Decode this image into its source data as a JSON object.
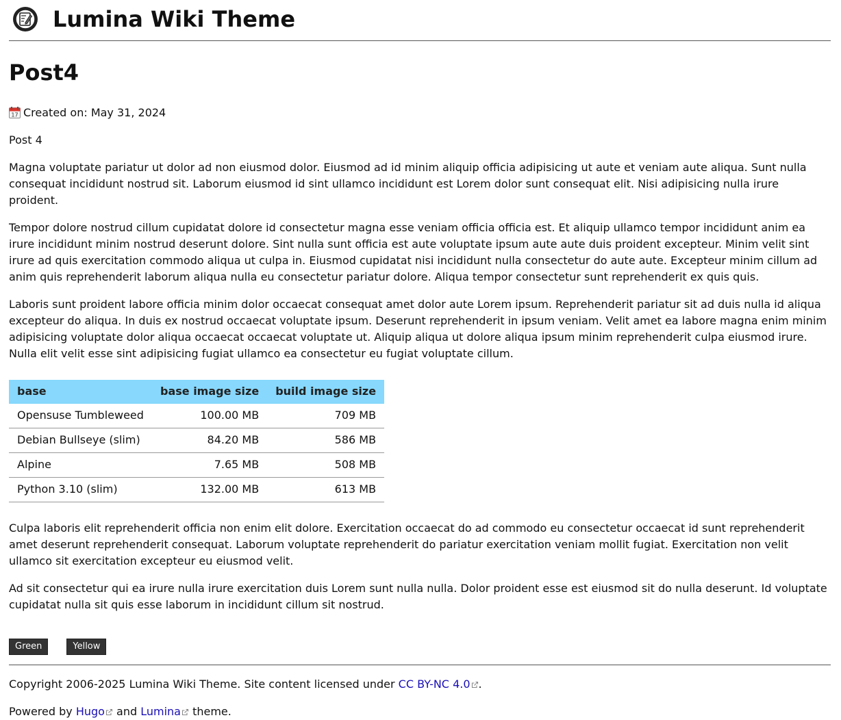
{
  "site": {
    "title": "Lumina Wiki Theme",
    "logo_icon": "notebook-pen-logo-icon"
  },
  "post": {
    "title": "Post4",
    "created_label": "Created on: May 31, 2024",
    "calendar_icon": "calendar-icon",
    "lead": "Post 4",
    "paragraphs": [
      "Magna voluptate pariatur ut dolor ad non eiusmod dolor. Eiusmod ad id minim aliquip officia adipisicing ut aute et veniam aute aliqua. Sunt nulla consequat incididunt nostrud sit. Laborum eiusmod id sint ullamco incididunt est Lorem dolor sunt consequat elit. Nisi adipisicing nulla irure proident.",
      "Tempor dolore nostrud cillum cupidatat dolore id consectetur magna esse veniam officia officia est. Et aliquip ullamco tempor incididunt anim ea irure incididunt minim nostrud deserunt dolore. Sint nulla sunt officia est aute voluptate ipsum aute aute duis proident excepteur. Minim velit sint irure ad quis exercitation commodo aliqua ut culpa in. Eiusmod cupidatat nisi incididunt nulla consectetur do aute aute. Excepteur minim cillum ad anim quis reprehenderit laborum aliqua nulla eu consectetur pariatur dolore. Aliqua tempor consectetur sunt reprehenderit ex quis quis.",
      "Laboris sunt proident labore officia minim dolor occaecat consequat amet dolor aute Lorem ipsum. Reprehenderit pariatur sit ad duis nulla id aliqua excepteur do aliqua. In duis ex nostrud occaecat voluptate ipsum. Deserunt reprehenderit in ipsum veniam. Velit amet ea labore magna enim minim adipisicing voluptate dolor aliqua occaecat occaecat voluptate ut. Aliquip aliqua ut dolore aliqua ipsum minim reprehenderit culpa eiusmod irure. Nulla elit velit esse sint adipisicing fugiat ullamco ea consectetur eu fugiat voluptate cillum."
    ],
    "table": {
      "headers": [
        "base",
        "base image size",
        "build image size"
      ],
      "rows": [
        [
          "Opensuse Tumbleweed",
          "100.00 MB",
          "709 MB"
        ],
        [
          "Debian Bullseye (slim)",
          "84.20 MB",
          "586 MB"
        ],
        [
          "Alpine",
          "7.65 MB",
          "508 MB"
        ],
        [
          "Python 3.10 (slim)",
          "132.00 MB",
          "613 MB"
        ]
      ]
    },
    "after_paragraphs": [
      "Culpa laboris elit reprehenderit officia non enim elit dolore. Exercitation occaecat do ad commodo eu consectetur occaecat id sunt reprehenderit amet deserunt reprehenderit consequat. Laborum voluptate reprehenderit do pariatur exercitation veniam mollit fugiat. Exercitation non velit ullamco sit exercitation excepteur eu eiusmod velit.",
      "Ad sit consectetur qui ea irure nulla irure exercitation duis Lorem sunt nulla nulla. Dolor proident esse est eiusmod sit do nulla deserunt. Id voluptate cupidatat nulla sit quis esse laborum in incididunt cillum sit nostrud."
    ],
    "tags": [
      "Green",
      "Yellow"
    ]
  },
  "footer": {
    "copyright_prefix": "Copyright 2006-2025 Lumina Wiki Theme. Site content licensed under ",
    "license_link": "CC BY-NC 4.0",
    "copyright_suffix": ".",
    "powered_prefix": "Powered by ",
    "hugo_link": "Hugo",
    "and_text": " and ",
    "lumina_link": "Lumina",
    "theme_suffix": " theme.",
    "external_link_icon": "external-link-icon",
    "link_color": "#1a0fb5"
  },
  "colors": {
    "table_header_bg": "#87d8fc",
    "tag_bg": "#333333"
  }
}
